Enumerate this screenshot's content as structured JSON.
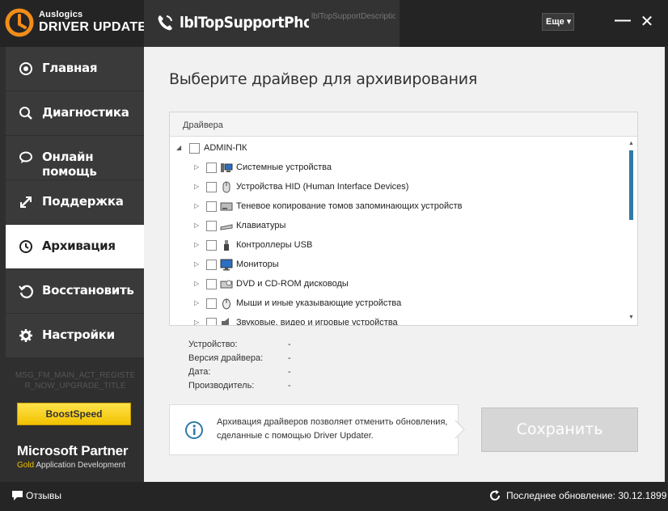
{
  "app": {
    "brand_small": "Auslogics",
    "brand_big": "DRIVER UPDATER",
    "phone_label": "lblTopSupportPhor",
    "phone_description": "lblTopSupportDescription",
    "more_label": "Еще ▾",
    "minimize_glyph": "—",
    "close_glyph": "✕"
  },
  "sidebar": {
    "items": [
      {
        "label": "Главная",
        "icon": "home-icon"
      },
      {
        "label": "Диагностика",
        "icon": "search-icon"
      },
      {
        "label": "Онлайн помощь",
        "icon": "chat-icon"
      },
      {
        "label": "Поддержка",
        "icon": "support-icon"
      },
      {
        "label": "Архивация",
        "icon": "clock-icon"
      },
      {
        "label": "Восстановить",
        "icon": "restore-icon"
      },
      {
        "label": "Настройки",
        "icon": "gear-icon"
      }
    ],
    "active_index": 4,
    "note": "MSG_FM_MAIN_ACT_REGISTER_NOW_UPGRADE_TITLE",
    "boost_label": "BoostSpeed",
    "partner_title": "Microsoft Partner",
    "partner_gold": "Gold",
    "partner_sub": " Application Development"
  },
  "main": {
    "title": "Выберите драйвер для архивирования",
    "tree_header": "Драйвера",
    "tree": [
      {
        "label": "ADMIN-ПК",
        "level": 0,
        "expanded": true,
        "icon": "computer-icon"
      },
      {
        "label": "Системные устройства",
        "level": 1,
        "icon": "system-devices-icon"
      },
      {
        "label": "Устройства HID (Human Interface Devices)",
        "level": 1,
        "icon": "hid-icon"
      },
      {
        "label": "Теневое копирование томов запоминающих устройств",
        "level": 1,
        "icon": "storage-icon"
      },
      {
        "label": "Клавиатуры",
        "level": 1,
        "icon": "keyboard-icon"
      },
      {
        "label": "Контроллеры USB",
        "level": 1,
        "icon": "usb-icon"
      },
      {
        "label": "Мониторы",
        "level": 1,
        "icon": "monitor-icon"
      },
      {
        "label": "DVD и CD-ROM дисководы",
        "level": 1,
        "icon": "dvd-icon"
      },
      {
        "label": "Мыши и иные указывающие устройства",
        "level": 1,
        "icon": "mouse-icon"
      },
      {
        "label": "Звуковые, видео и игровые устройства",
        "level": 1,
        "icon": "speaker-icon"
      }
    ],
    "props": [
      {
        "key": "Устройство:",
        "value": "-"
      },
      {
        "key": "Версия драйвера:",
        "value": "-"
      },
      {
        "key": "Дата:",
        "value": "-"
      },
      {
        "key": "Производитель:",
        "value": "-"
      }
    ],
    "info_text": "Архивация драйверов позволяет отменить обновления, сделанные с помощью Driver Updater.",
    "save_label": "Сохранить"
  },
  "status": {
    "feedback_label": "Отзывы",
    "last_update": "Последнее обновление: 30.12.1899"
  },
  "colors": {
    "accent": "#2f7aa7",
    "brand_orange": "#f28c1a",
    "boost_yellow": "#f2c200"
  }
}
